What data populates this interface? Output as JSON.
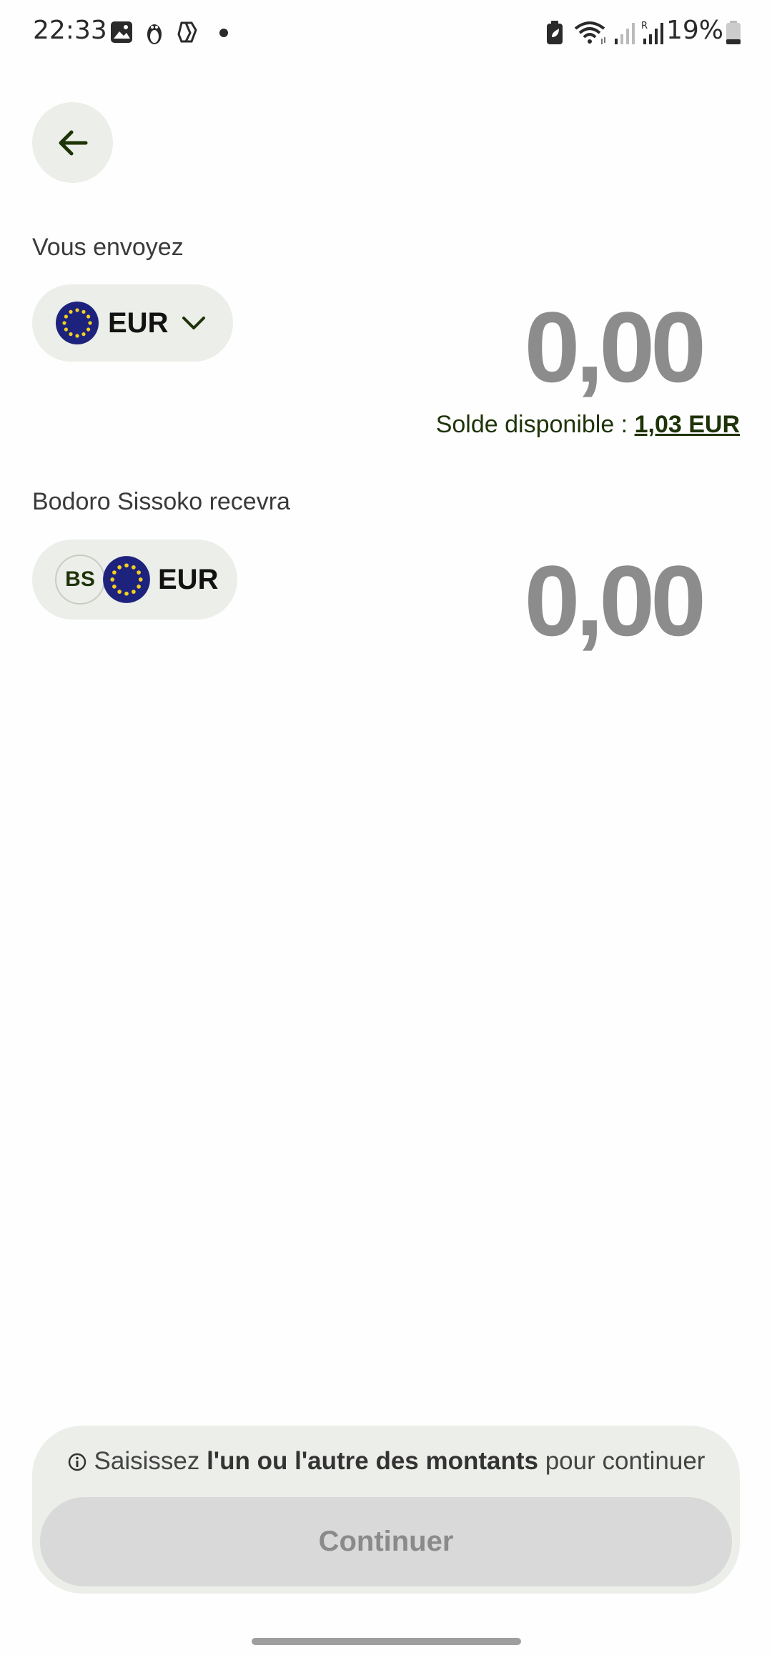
{
  "status_bar": {
    "time": "22:33",
    "battery": "19%"
  },
  "send_section": {
    "label": "Vous envoyez",
    "currency": "EUR",
    "amount": "0,00",
    "balance_label": "Solde disponible : ",
    "balance_value": "1,03 EUR"
  },
  "receive_section": {
    "label": "Bodoro Sissoko recevra",
    "recipient_initials": "BS",
    "currency": "EUR",
    "amount": "0,00"
  },
  "footer": {
    "info_prefix": "Saisissez ",
    "info_bold": "l'un ou l'autre des montants",
    "info_suffix": " pour continuer",
    "continue_label": "Continuer"
  },
  "colors": {
    "accent": "#1e3307",
    "pill_bg": "#eceee9",
    "amount": "#8c8c8c",
    "eu_blue": "#1d237d",
    "eu_star": "#f4cf1f"
  }
}
